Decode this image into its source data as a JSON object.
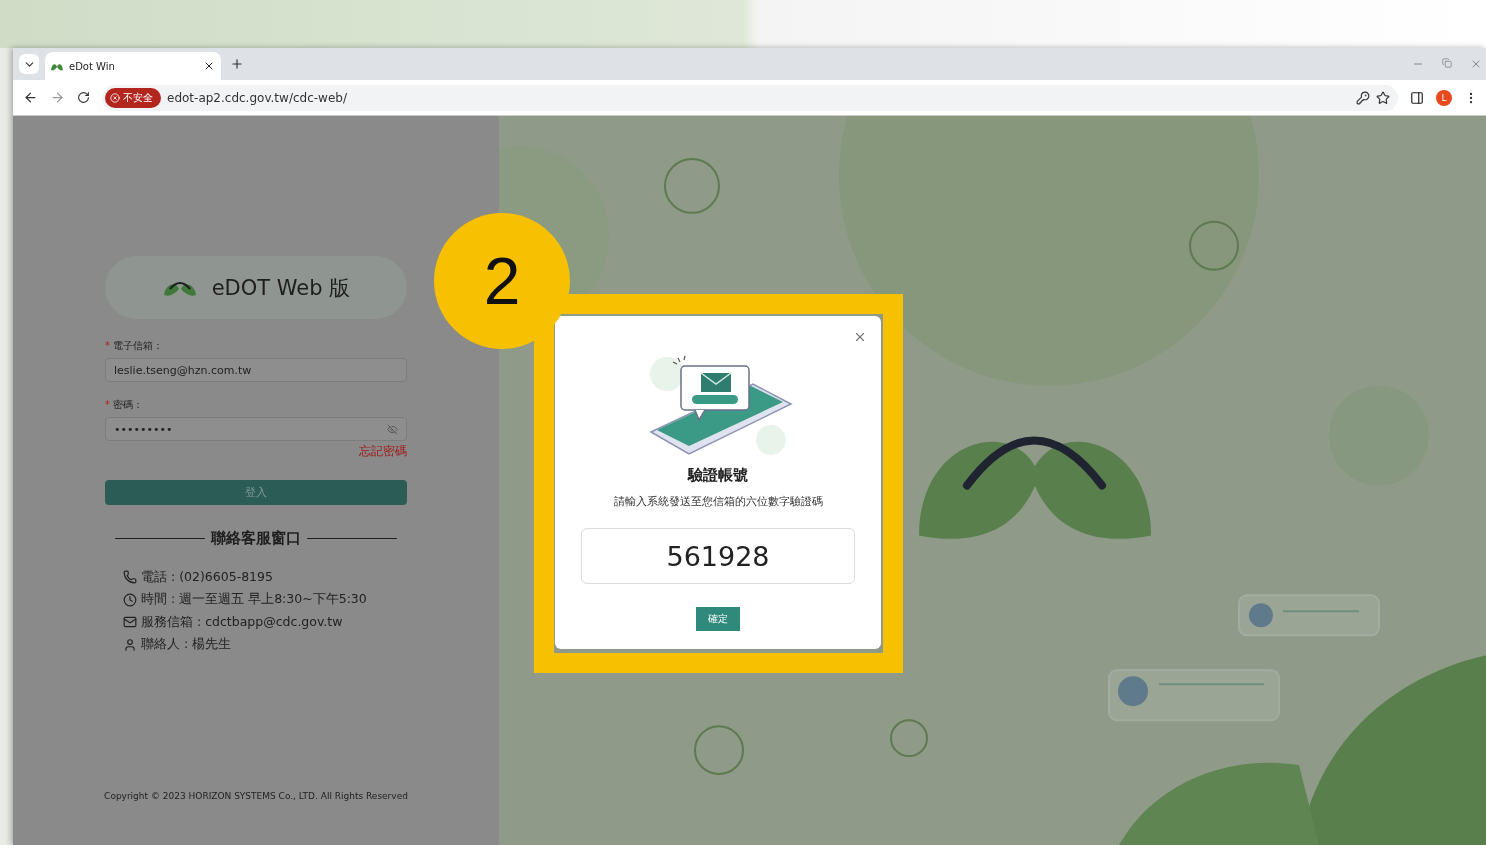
{
  "annotation": {
    "step": "2"
  },
  "browser": {
    "tab_title": "eDot Win",
    "security_badge": "不安全",
    "url": "edot-ap2.cdc.gov.tw/cdc-web/",
    "profile_initial": "L"
  },
  "login": {
    "title": "eDOT Web 版",
    "fields": [
      {
        "kind": "text",
        "required_mark": "*",
        "label": "電子信箱：",
        "value": "leslie.tseng@hzn.com.tw"
      },
      {
        "kind": "password",
        "required_mark": "*",
        "label": "密碼：",
        "value": "•••••••••"
      }
    ],
    "forgot_link": "忘記密碼",
    "login_button": "登入",
    "contact_heading": "聯絡客服窗口",
    "contacts": [
      {
        "kind": "phone",
        "text": "電話 : (02)6605-8195"
      },
      {
        "kind": "clock",
        "text": "時間 : 週一至週五 早上8:30~下午5:30"
      },
      {
        "kind": "mail",
        "text": "服務信箱 : cdctbapp@cdc.gov.tw"
      },
      {
        "kind": "person",
        "text": "聯絡人 : 楊先生"
      }
    ],
    "copyright": "Copyright © 2023 HORIZON SYSTEMS Co., LTD. All Rights Reserved"
  },
  "dialog": {
    "title": "驗證帳號",
    "instruction": "請輸入系統發送至您信箱的六位數字驗證碼",
    "code": "561928",
    "confirm_button": "確定"
  }
}
